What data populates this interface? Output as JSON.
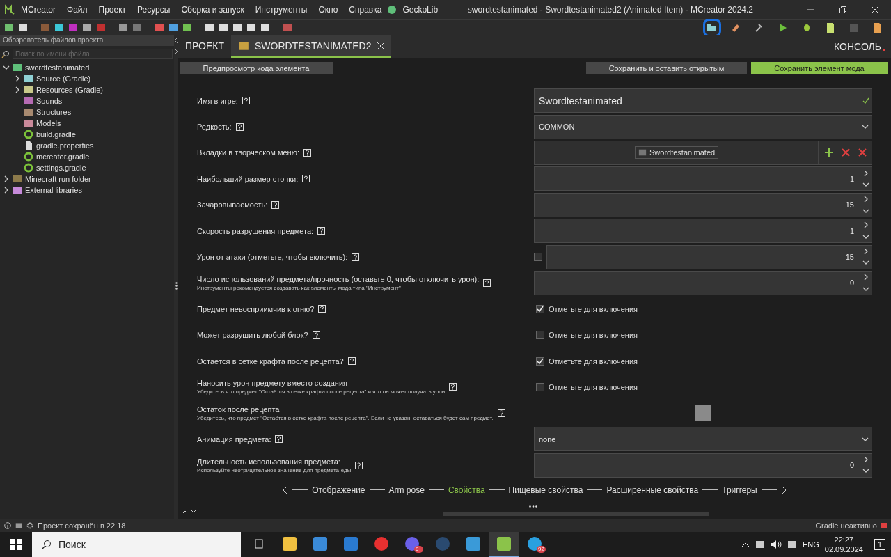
{
  "window": {
    "title": "swordtestanimated - Swordtestanimated2 (Animated Item) - MCreator 2024.2"
  },
  "menu": [
    "MCreator",
    "Файл",
    "Проект",
    "Ресурсы",
    "Сборка и запуск",
    "Инструменты",
    "Окно",
    "Справка",
    "GeckoLib"
  ],
  "right_tools": [
    {
      "kind": "folder",
      "circled": true
    },
    {
      "kind": "eraser",
      "circled": false
    },
    {
      "kind": "hammer",
      "circled": false
    },
    {
      "kind": "play",
      "circled": false
    },
    {
      "kind": "bug",
      "circled": false
    },
    {
      "kind": "page",
      "circled": false
    },
    {
      "kind": "stop",
      "circled": false
    },
    {
      "kind": "export",
      "circled": false
    }
  ],
  "sidebar": {
    "title": "Обозреватель файлов проекта",
    "search": {
      "placeholder": "Поиск по имени файла"
    },
    "tree": [
      {
        "label": "swordtestanimated",
        "kind": "workspace",
        "expanded": true,
        "children": [
          {
            "label": "Source (Gradle)",
            "kind": "source",
            "expanded": false
          },
          {
            "label": "Resources (Gradle)",
            "kind": "resources",
            "expanded": false
          },
          {
            "label": "Sounds",
            "kind": "sounds"
          },
          {
            "label": "Structures",
            "kind": "structures"
          },
          {
            "label": "Models",
            "kind": "models"
          },
          {
            "label": "build.gradle",
            "kind": "gradle"
          },
          {
            "label": "gradle.properties",
            "kind": "file"
          },
          {
            "label": "mcreator.gradle",
            "kind": "gradle"
          },
          {
            "label": "settings.gradle",
            "kind": "gradle"
          }
        ]
      },
      {
        "label": "Minecraft run folder",
        "kind": "run",
        "expanded": false
      },
      {
        "label": "External libraries",
        "kind": "libs",
        "expanded": false
      }
    ]
  },
  "tabs": [
    {
      "label": "ПРОЕКТ",
      "selected": false,
      "closable": false
    },
    {
      "label": "SWORDTESTANIMATED2",
      "selected": true,
      "closable": true
    }
  ],
  "console": "КОНСОЛЬ",
  "actions": {
    "preview": "Предпросмотр кода элемента",
    "save_open": "Сохранить и оставить открытым",
    "save": "Сохранить элемент мода"
  },
  "form": [
    {
      "kind": "text",
      "label": "Имя в игре:",
      "value": "Swordtestanimated",
      "valid": true
    },
    {
      "kind": "dropdown",
      "label": "Редкость:",
      "value": "COMMON"
    },
    {
      "kind": "list",
      "label": "Вкладки в творческом меню:",
      "items": [
        "Swordtestanimated"
      ]
    },
    {
      "kind": "number",
      "label": "Наибольший размер стопки:",
      "value": "1"
    },
    {
      "kind": "number",
      "label": "Зачаровываемость:",
      "value": "15"
    },
    {
      "kind": "number",
      "label": "Скорость разрушения предмета:",
      "value": "1"
    },
    {
      "kind": "checknumber",
      "label": "Урон от атаки (отметьте, чтобы включить):",
      "value": "15",
      "checked": false
    },
    {
      "kind": "number",
      "label": "Число использований предмета/прочность (оставьте 0, чтобы отключить урон):",
      "hint": "Инструменты рекомендуется создавать как элементы мода типа \"Инструмент\"",
      "value": "0"
    },
    {
      "kind": "checkbox",
      "label": "Предмет невосприимчив к огню?",
      "text": "Отметьте для включения",
      "checked": true
    },
    {
      "kind": "checkbox",
      "label": "Может разрушить любой блок?",
      "text": "Отметьте для включения",
      "checked": false
    },
    {
      "kind": "checkbox",
      "label": "Остаётся в сетке крафта после рецепта?",
      "text": "Отметьте для включения",
      "checked": true
    },
    {
      "kind": "checkbox",
      "label": "Наносить урон предмету вместо создания",
      "hint": "Убедитесь что предмет \"Остаётся в сетке крафта после рецепта\" и что он может получать урон",
      "text": "Отметьте для включения",
      "checked": false
    },
    {
      "kind": "slot",
      "label": "Остаток после рецепта",
      "hint": "Убедитесь, что предмет \"Остаётся в сетке крафта после рецепта\". Если не указан, оставаться будет сам предмет."
    },
    {
      "kind": "dropdown",
      "label": "Анимация предмета:",
      "value": "none"
    },
    {
      "kind": "number",
      "label": "Длительность использования предмета:",
      "hint": "Используйте неотрицательное значение для предмета-еды",
      "value": "0"
    }
  ],
  "nav": [
    {
      "label": "Отображение",
      "selected": false
    },
    {
      "label": "Arm pose",
      "selected": false
    },
    {
      "label": "Свойства",
      "selected": true
    },
    {
      "label": "Пищевые свойства",
      "selected": false
    },
    {
      "label": "Расширенные свойства",
      "selected": false
    },
    {
      "label": "Триггеры",
      "selected": false
    }
  ],
  "status": {
    "text": "Проект сохранён в 22:18",
    "gradle": "Gradle неактивно"
  },
  "taskbar": {
    "search": "Поиск",
    "apps": [
      {
        "kind": "taskview",
        "selected": false
      },
      {
        "kind": "explorer",
        "selected": false
      },
      {
        "kind": "store",
        "selected": false
      },
      {
        "kind": "mail",
        "selected": false
      },
      {
        "kind": "yandex",
        "selected": false
      },
      {
        "kind": "discord",
        "selected": false,
        "badge": "9+"
      },
      {
        "kind": "steam",
        "selected": false
      },
      {
        "kind": "launcher",
        "selected": false
      },
      {
        "kind": "mcreator",
        "selected": true
      },
      {
        "kind": "telegram",
        "selected": false,
        "badge": "92"
      }
    ],
    "lang": "ENG",
    "time": "22:27",
    "date": "02.09.2024",
    "notifications": "1"
  }
}
